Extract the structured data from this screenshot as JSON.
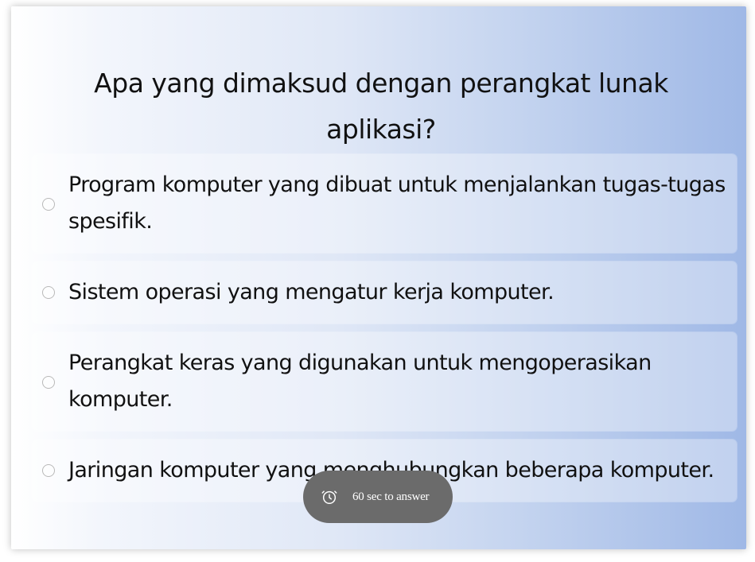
{
  "quiz": {
    "question": "Apa yang dimaksud dengan perangkat lunak aplikasi?",
    "options": [
      {
        "label": "Program komputer yang dibuat untuk menjalankan tugas-tugas spesifik."
      },
      {
        "label": "Sistem operasi yang mengatur kerja komputer."
      },
      {
        "label": "Perangkat keras yang digunakan untuk mengoperasikan komputer."
      },
      {
        "label": "Jaringan komputer yang menghubungkan beberapa komputer."
      }
    ]
  },
  "timer": {
    "text": "60 sec to answer",
    "icon": "alarm-clock-icon"
  },
  "colors": {
    "gradient_start": "#ffffff",
    "gradient_end": "#9fb8e6",
    "timer_bg": "#6b6b6b",
    "text": "#111111"
  }
}
